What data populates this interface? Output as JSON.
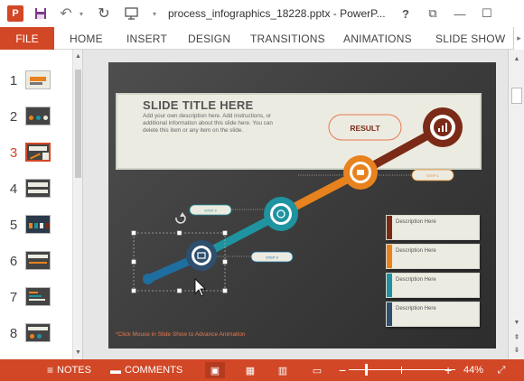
{
  "titlebar": {
    "app_icon_letter": "P",
    "document_title": "process_infographics_18228.pptx - PowerP...",
    "help": "?",
    "restore": "⧉",
    "minimize": "—",
    "maximize": "☐"
  },
  "ribbon": {
    "file": "FILE",
    "tabs": [
      "HOME",
      "INSERT",
      "DESIGN",
      "TRANSITIONS",
      "ANIMATIONS",
      "SLIDE SHOW"
    ]
  },
  "thumbnails": [
    {
      "number": "1",
      "active": false
    },
    {
      "number": "2",
      "active": false
    },
    {
      "number": "3",
      "active": true
    },
    {
      "number": "4",
      "active": false
    },
    {
      "number": "5",
      "active": false
    },
    {
      "number": "6",
      "active": false
    },
    {
      "number": "7",
      "active": false
    },
    {
      "number": "8",
      "active": false
    }
  ],
  "slide": {
    "title": "SLIDE TITLE HERE",
    "subtitle": "Add your own description here. Add instructions, or additional information about this slide here. You can delete this item or any item on the slide.",
    "result_label": "RESULT",
    "step_labels": [
      "STEP 2",
      "STEP 3",
      "STEP 1"
    ],
    "descriptions": [
      "Description Here",
      "Description Here",
      "Description Here",
      "Description Here"
    ],
    "description_colors": [
      "#7a2a16",
      "#e8821e",
      "#1f93a0",
      "#2e4f6e"
    ],
    "animation_note": "*Click Mouse in Slide Show to Advance Animation"
  },
  "colors": {
    "accent": "#d24726",
    "teal": "#1f93a0",
    "orange": "#e8821e",
    "dark_red": "#7a2a16",
    "navy": "#2e4f6e"
  },
  "statusbar": {
    "notes": "NOTES",
    "comments": "COMMENTS",
    "zoom_minus": "−",
    "zoom_plus": "+",
    "zoom_level": "44%"
  }
}
